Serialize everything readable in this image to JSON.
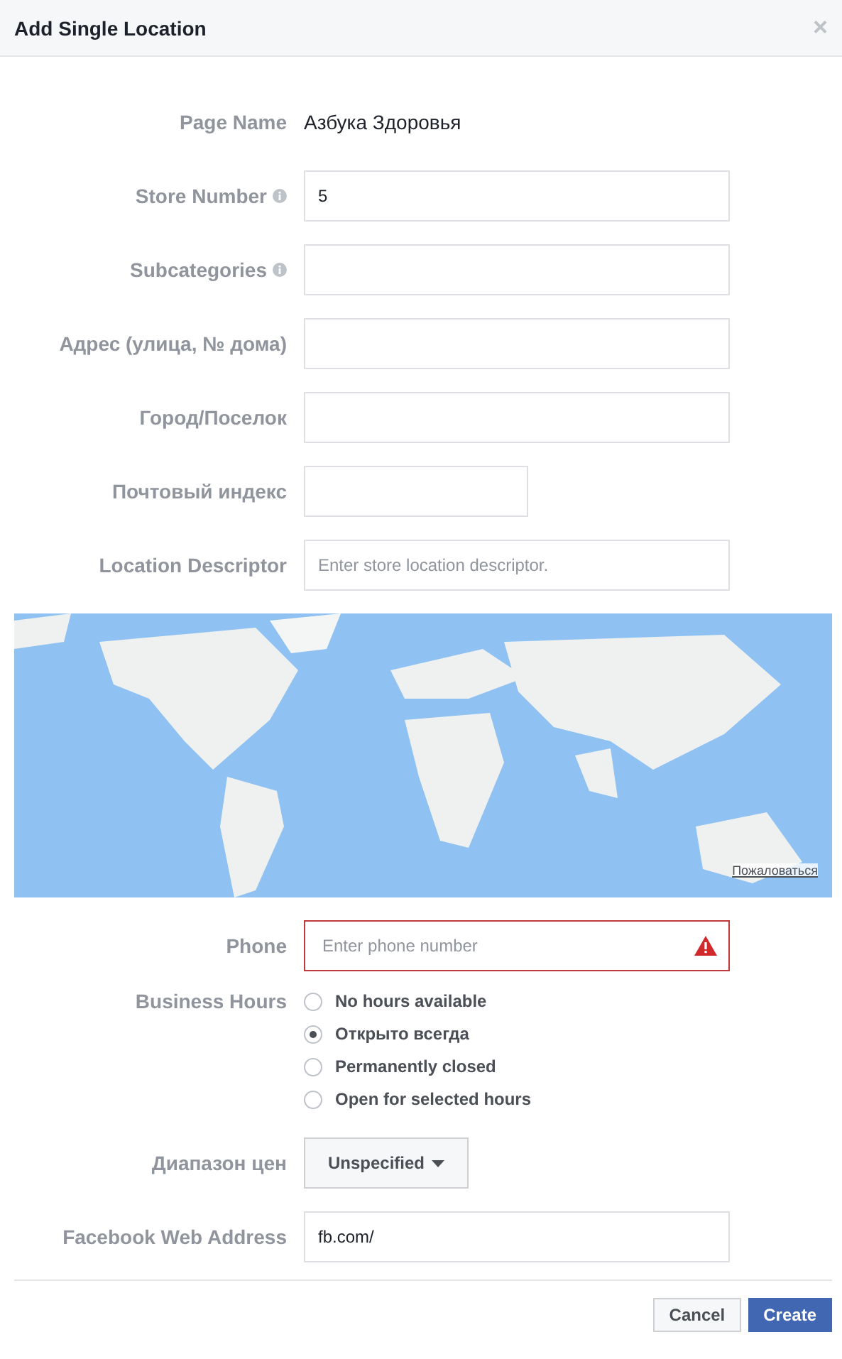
{
  "dialog": {
    "title": "Add Single Location",
    "close": "×"
  },
  "fields": [
    {
      "kind": "text",
      "label": "Page Name",
      "value": "Азбука Здоровья"
    },
    {
      "kind": "input",
      "label": "Store Number",
      "value": "5",
      "info": true
    },
    {
      "kind": "input",
      "label": "Subcategories",
      "info": true
    },
    {
      "kind": "input",
      "label": "Адрес (улица, № дома)"
    },
    {
      "kind": "input",
      "label": "Город/Поселок"
    },
    {
      "kind": "input",
      "label": "Почтовый индекс",
      "narrow": true
    },
    {
      "kind": "input",
      "label": "Location Descriptor",
      "placeholder": "Enter store location descriptor."
    }
  ],
  "map": {
    "kind": "picture",
    "report_link": "Пожаловаться"
  },
  "phone": {
    "label": "Phone",
    "placeholder": "Enter phone number",
    "error": true
  },
  "business_hours": {
    "label": "Business Hours",
    "options": [
      {
        "label": "No hours available",
        "selected": false
      },
      {
        "label": "Открыто всегда",
        "selected": true
      },
      {
        "label": "Permanently closed",
        "selected": false
      },
      {
        "label": "Open for selected hours",
        "selected": false
      }
    ]
  },
  "price_range": {
    "label": "Диапазон цен",
    "value": "Unspecified"
  },
  "web_address": {
    "label": "Facebook Web Address",
    "value": "fb.com/"
  },
  "buttons": [
    {
      "label": "Cancel",
      "kind": "secondary"
    },
    {
      "label": "Create",
      "kind": "primary"
    }
  ]
}
